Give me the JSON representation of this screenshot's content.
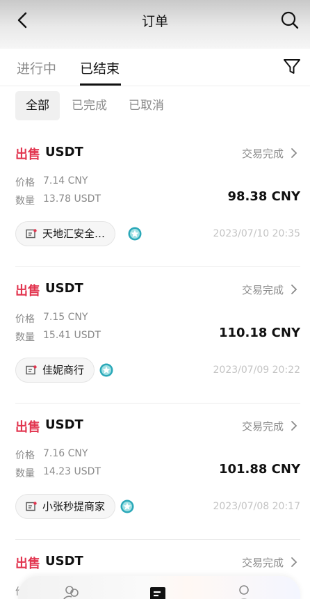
{
  "header": {
    "title": "订单",
    "back_icon": "chevron-left-icon",
    "search_icon": "search-icon"
  },
  "tabs": [
    {
      "label": "进行中",
      "active": false
    },
    {
      "label": "已结束",
      "active": true
    }
  ],
  "filter_icon": "filter-icon",
  "chips": [
    {
      "label": "全部",
      "selected": true
    },
    {
      "label": "已完成",
      "selected": false
    },
    {
      "label": "已取消",
      "selected": false
    }
  ],
  "labels": {
    "price": "价格",
    "quantity": "数量"
  },
  "orders": [
    {
      "side": "出售",
      "asset": "USDT",
      "status": "交易完成",
      "price": "7.14 CNY",
      "quantity": "13.78 USDT",
      "total": "98.38 CNY",
      "merchant": "天地汇安全…",
      "time": "2023/07/10 20:35"
    },
    {
      "side": "出售",
      "asset": "USDT",
      "status": "交易完成",
      "price": "7.15 CNY",
      "quantity": "15.41 USDT",
      "total": "110.18 CNY",
      "merchant": "佳妮商行",
      "time": "2023/07/09 20:22"
    },
    {
      "side": "出售",
      "asset": "USDT",
      "status": "交易完成",
      "price": "7.16 CNY",
      "quantity": "14.23 USDT",
      "total": "101.88 CNY",
      "merchant": "小张秒提商家",
      "time": "2023/07/08 20:17"
    },
    {
      "side": "出售",
      "asset": "USDT",
      "status": "交易完成",
      "price": "",
      "quantity": "",
      "total": "",
      "merchant": "",
      "time": ""
    }
  ],
  "colors": {
    "sell": "#e2354f",
    "badge": "#2aa8b8"
  },
  "bottom_nav": [
    "community-icon",
    "orders-icon",
    "profile-icon"
  ]
}
